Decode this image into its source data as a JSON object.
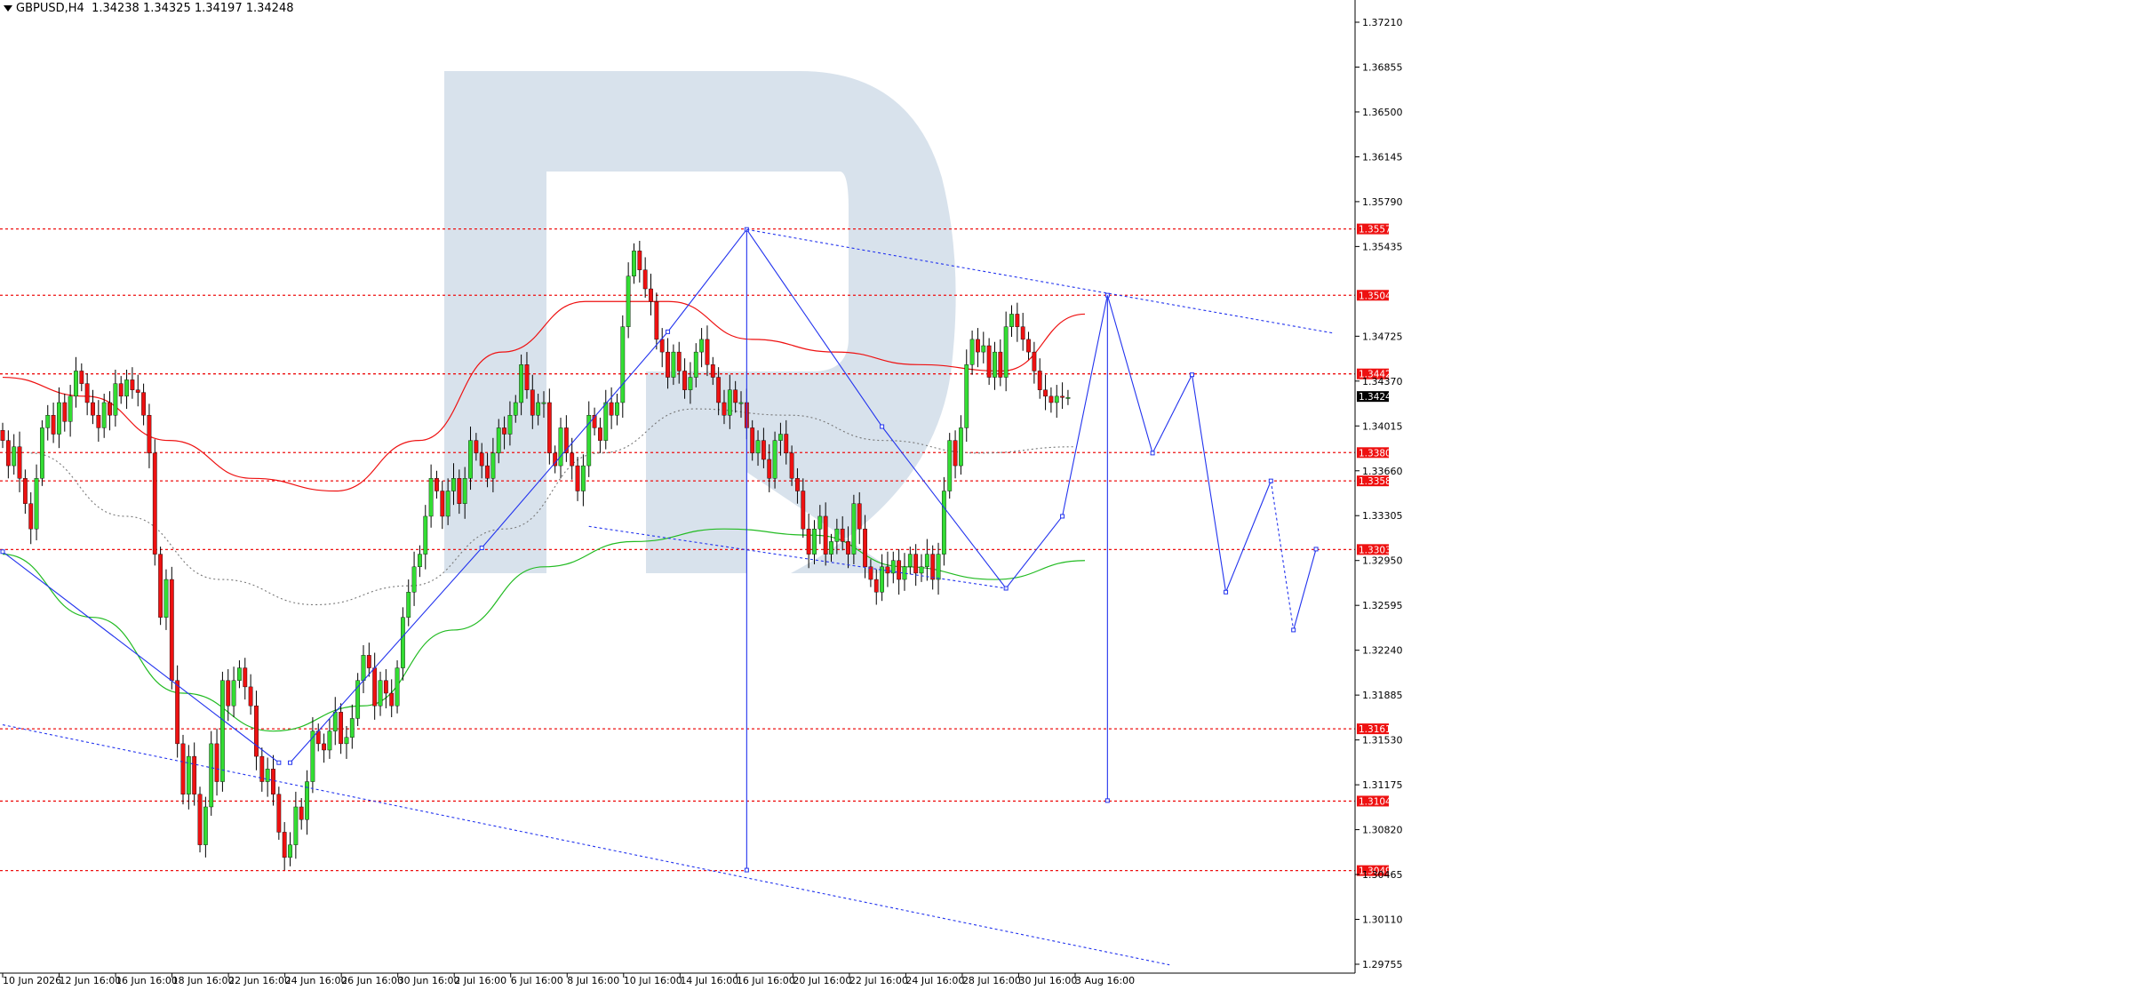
{
  "header": {
    "symbol": "GBPUSD,H4",
    "ohlc": "1.34238 1.34325 1.34197 1.34248"
  },
  "colors": {
    "background": "#ffffff",
    "bull_candle": "#33dd33",
    "bear_candle": "#ee1111",
    "wave_line": "#2233ee",
    "level_line": "#ee1111",
    "ma_red": "#ee1111",
    "ma_green": "#22bb22",
    "ma_dotted": "#777777",
    "watermark": "#d6e0eb",
    "price_tag": "#ee1111",
    "current_tag": "#000000"
  },
  "chart_data": {
    "type": "candlestick",
    "title": "GBPUSD,H4",
    "y_range": [
      1.296,
      1.374
    ],
    "y_ticks": [
      "1.37210",
      "1.36855",
      "1.36500",
      "1.36145",
      "1.35790",
      "1.35435",
      "1.34725",
      "1.34370",
      "1.34015",
      "1.33660",
      "1.33305",
      "1.32950",
      "1.32595",
      "1.32240",
      "1.31885",
      "1.31530",
      "1.31175",
      "1.30820",
      "1.30465",
      "1.30110",
      "1.29755"
    ],
    "x_labels": [
      "10 Jun 2026",
      "12 Jun 16:00",
      "16 Jun 16:00",
      "18 Jun 16:00",
      "22 Jun 16:00",
      "24 Jun 16:00",
      "26 Jun 16:00",
      "30 Jun 16:00",
      "2 Jul 16:00",
      "6 Jul 16:00",
      "8 Jul 16:00",
      "10 Jul 16:00",
      "14 Jul 16:00",
      "16 Jul 16:00",
      "20 Jul 16:00",
      "22 Jul 16:00",
      "24 Jul 16:00",
      "28 Jul 16:00",
      "30 Jul 16:00",
      "3 Aug 16:00"
    ],
    "levels": [
      {
        "label": "1.35574",
        "value": 1.35574
      },
      {
        "label": "1.35049",
        "value": 1.35049
      },
      {
        "label": "1.34427",
        "value": 1.34427
      },
      {
        "label": "1.33804",
        "value": 1.33804
      },
      {
        "label": "1.33580",
        "value": 1.3358
      },
      {
        "label": "1.33037",
        "value": 1.33037
      },
      {
        "label": "1.31618",
        "value": 1.31618
      },
      {
        "label": "1.31046",
        "value": 1.31046
      },
      {
        "label": "1.30496",
        "value": 1.30496
      }
    ],
    "current_price": {
      "label": "1.34248",
      "value": 1.34248
    },
    "bar_count": 196,
    "closes": [
      1.339,
      1.337,
      1.3385,
      1.336,
      1.334,
      1.332,
      1.336,
      1.34,
      1.341,
      1.3395,
      1.342,
      1.3405,
      1.3425,
      1.3445,
      1.3435,
      1.342,
      1.341,
      1.34,
      1.342,
      1.341,
      1.3435,
      1.3425,
      1.3438,
      1.343,
      1.3428,
      1.341,
      1.338,
      1.33,
      1.325,
      1.328,
      1.32,
      1.315,
      1.311,
      1.314,
      1.311,
      1.307,
      1.31,
      1.315,
      1.312,
      1.32,
      1.318,
      1.32,
      1.321,
      1.3195,
      1.318,
      1.314,
      1.312,
      1.313,
      1.311,
      1.308,
      1.306,
      1.307,
      1.31,
      1.309,
      1.312,
      1.316,
      1.315,
      1.3145,
      1.316,
      1.3175,
      1.315,
      1.3155,
      1.317,
      1.32,
      1.322,
      1.321,
      1.318,
      1.32,
      1.319,
      1.318,
      1.321,
      1.325,
      1.327,
      1.329,
      1.33,
      1.333,
      1.336,
      1.335,
      1.333,
      1.335,
      1.336,
      1.334,
      1.336,
      1.339,
      1.338,
      1.337,
      1.336,
      1.338,
      1.34,
      1.3395,
      1.341,
      1.342,
      1.345,
      1.343,
      1.341,
      1.342,
      1.342,
      1.338,
      1.337,
      1.34,
      1.338,
      1.337,
      1.335,
      1.337,
      1.341,
      1.34,
      1.339,
      1.342,
      1.341,
      1.342,
      1.348,
      1.352,
      1.354,
      1.3525,
      1.351,
      1.35,
      1.347,
      1.346,
      1.344,
      1.346,
      1.3445,
      1.343,
      1.344,
      1.346,
      1.347,
      1.345,
      1.344,
      1.342,
      1.341,
      1.343,
      1.342,
      1.342,
      1.34,
      1.338,
      1.339,
      1.3375,
      1.336,
      1.339,
      1.3395,
      1.338,
      1.336,
      1.335,
      1.332,
      1.33,
      1.332,
      1.333,
      1.33,
      1.331,
      1.332,
      1.331,
      1.33,
      1.334,
      1.332,
      1.329,
      1.328,
      1.327,
      1.329,
      1.3285,
      1.3295,
      1.328,
      1.329,
      1.33,
      1.3285,
      1.329,
      1.33,
      1.328,
      1.33,
      1.335,
      1.339,
      1.337,
      1.34,
      1.345,
      1.347,
      1.346,
      1.3465,
      1.344,
      1.346,
      1.344,
      1.348,
      1.349,
      1.348,
      1.347,
      1.346,
      1.3445,
      1.343,
      1.3425,
      1.342,
      1.3425,
      1.3424,
      1.3424
    ],
    "wave_structure": [
      {
        "bar": 0,
        "price": 1.3302
      },
      {
        "bar": 49,
        "price": 1.3135
      },
      {
        "bar": 51,
        "price": 1.3135
      },
      {
        "bar": 85,
        "price": 1.3305
      },
      {
        "bar": 118,
        "price": 1.3476
      },
      {
        "bar": 132,
        "price": 1.3557
      },
      {
        "bar": 156,
        "price": 1.3401
      },
      {
        "bar": 178,
        "price": 1.3273
      },
      {
        "bar": 188,
        "price": 1.333
      },
      {
        "bar": 196,
        "price": 1.3505
      },
      {
        "bar": 204,
        "price": 1.338
      },
      {
        "bar": 211,
        "price": 1.3442
      },
      {
        "bar": 217,
        "price": 1.327
      },
      {
        "bar": 225,
        "price": 1.3358
      },
      {
        "bar": 229,
        "price": 1.324
      },
      {
        "bar": 233,
        "price": 1.3304
      }
    ],
    "verticals": [
      {
        "bar": 132,
        "top": 1.3557,
        "bottom": 1.305
      },
      {
        "bar": 196,
        "top": 1.3505,
        "bottom": 1.3105
      }
    ],
    "trend_lines": [
      {
        "from": {
          "bar": 0,
          "price": 1.3165
        },
        "to": {
          "bar": 207,
          "price": 1.2975
        }
      },
      {
        "from": {
          "bar": 132,
          "price": 1.3557
        },
        "to": {
          "bar": 236,
          "price": 1.3475
        }
      },
      {
        "from": {
          "bar": 104,
          "price": 1.3322
        },
        "to": {
          "bar": 178,
          "price": 1.3273
        }
      }
    ],
    "ma_red": [
      1.344,
      1.3425,
      1.339,
      1.336,
      1.335,
      1.339,
      1.346,
      1.35,
      1.35,
      1.347,
      1.346,
      1.345,
      1.3445,
      1.349
    ],
    "ma_green": [
      1.33,
      1.325,
      1.319,
      1.316,
      1.318,
      1.324,
      1.329,
      1.331,
      1.332,
      1.3315,
      1.329,
      1.328,
      1.3295
    ],
    "ma_dotted": [
      1.338,
      1.333,
      1.328,
      1.326,
      1.3275,
      1.332,
      1.338,
      1.3415,
      1.341,
      1.339,
      1.338,
      1.3385
    ]
  }
}
